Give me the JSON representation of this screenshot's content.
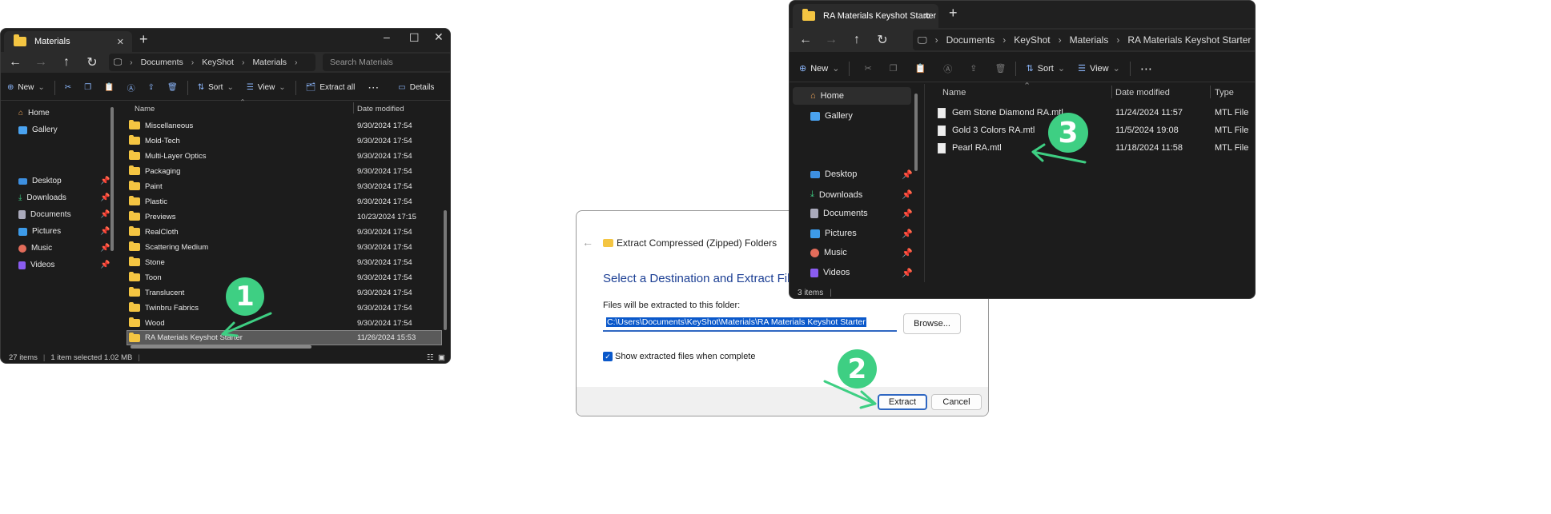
{
  "colors": {
    "accent": "#3ecf83",
    "folder": "#f4c542",
    "dark_bg": "#1c1c1c",
    "selection": "#0a58ca"
  },
  "left_window": {
    "tab_title": "Materials",
    "breadcrumbs": [
      "Documents",
      "KeyShot",
      "Materials"
    ],
    "search_placeholder": "Search Materials",
    "toolbar": {
      "new": "New",
      "sort": "Sort",
      "view": "View",
      "extract_all": "Extract all",
      "details": "Details"
    },
    "nav": {
      "home": "Home",
      "gallery": "Gallery",
      "desktop": "Desktop",
      "downloads": "Downloads",
      "documents": "Documents",
      "pictures": "Pictures",
      "music": "Music",
      "videos": "Videos"
    },
    "columns": {
      "name": "Name",
      "date": "Date modified"
    },
    "rows": [
      {
        "name": "Miscellaneous",
        "date": "9/30/2024 17:54"
      },
      {
        "name": "Mold-Tech",
        "date": "9/30/2024 17:54"
      },
      {
        "name": "Multi-Layer Optics",
        "date": "9/30/2024 17:54"
      },
      {
        "name": "Packaging",
        "date": "9/30/2024 17:54"
      },
      {
        "name": "Paint",
        "date": "9/30/2024 17:54"
      },
      {
        "name": "Plastic",
        "date": "9/30/2024 17:54"
      },
      {
        "name": "Previews",
        "date": "10/23/2024 17:15"
      },
      {
        "name": "RealCloth",
        "date": "9/30/2024 17:54"
      },
      {
        "name": "Scattering Medium",
        "date": "9/30/2024 17:54"
      },
      {
        "name": "Stone",
        "date": "9/30/2024 17:54"
      },
      {
        "name": "Toon",
        "date": "9/30/2024 17:54"
      },
      {
        "name": "Translucent",
        "date": "9/30/2024 17:54"
      },
      {
        "name": "Twinbru Fabrics",
        "date": "9/30/2024 17:54"
      },
      {
        "name": "Wood",
        "date": "9/30/2024 17:54"
      },
      {
        "name": "RA Materials Keyshot Starter",
        "date": "11/26/2024 15:53"
      }
    ],
    "status": {
      "items": "27 items",
      "selected": "1 item selected  1.02 MB"
    }
  },
  "dialog": {
    "window_title": "Extract Compressed (Zipped) Folders",
    "heading": "Select a Destination and Extract Files",
    "dest_label": "Files will be extracted to this folder:",
    "dest_value": "C:\\Users\\Documents\\KeyShot\\Materials\\RA Materials Keyshot Starter",
    "browse": "Browse...",
    "checkbox_label": "Show extracted files when complete",
    "checkbox_checked": true,
    "extract": "Extract",
    "cancel": "Cancel"
  },
  "right_window": {
    "tab_title": "RA Materials Keyshot Starter",
    "breadcrumbs": [
      "Documents",
      "KeyShot",
      "Materials",
      "RA Materials Keyshot Starter"
    ],
    "toolbar": {
      "new": "New",
      "sort": "Sort",
      "view": "View"
    },
    "nav": {
      "home": "Home",
      "gallery": "Gallery",
      "desktop": "Desktop",
      "downloads": "Downloads",
      "documents": "Documents",
      "pictures": "Pictures",
      "music": "Music",
      "videos": "Videos"
    },
    "columns": {
      "name": "Name",
      "date": "Date modified",
      "type": "Type"
    },
    "rows": [
      {
        "name": "Gem Stone Diamond RA.mtl",
        "date": "11/24/2024 11:57",
        "type": "MTL File"
      },
      {
        "name": "Gold 3 Colors RA.mtl",
        "date": "11/5/2024 19:08",
        "type": "MTL File"
      },
      {
        "name": "Pearl RA.mtl",
        "date": "11/18/2024 11:58",
        "type": "MTL File"
      }
    ],
    "status": {
      "items": "3 items"
    }
  },
  "badges": {
    "step1": "1",
    "step2": "2",
    "step3": "3"
  }
}
